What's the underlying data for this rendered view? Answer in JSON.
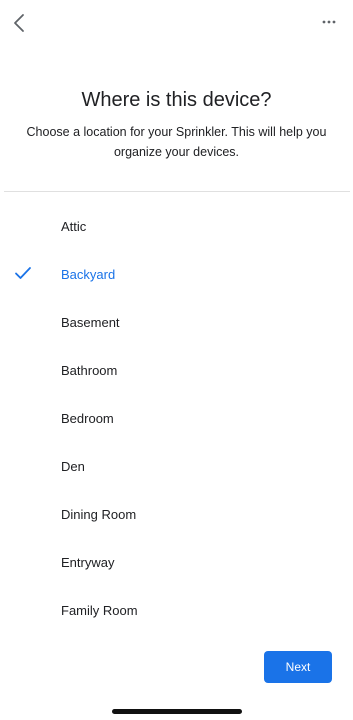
{
  "header": {
    "title": "Where is this device?",
    "subtitle": "Choose a location for your Sprinkler. This will help you organize your devices."
  },
  "locations": [
    {
      "label": "Attic",
      "selected": false
    },
    {
      "label": "Backyard",
      "selected": true
    },
    {
      "label": "Basement",
      "selected": false
    },
    {
      "label": "Bathroom",
      "selected": false
    },
    {
      "label": "Bedroom",
      "selected": false
    },
    {
      "label": "Den",
      "selected": false
    },
    {
      "label": "Dining Room",
      "selected": false
    },
    {
      "label": "Entryway",
      "selected": false
    },
    {
      "label": "Family Room",
      "selected": false
    }
  ],
  "footer": {
    "next_label": "Next"
  },
  "icons": {
    "back": "back-arrow-icon",
    "more": "more-horizontal-icon",
    "check": "checkmark-icon"
  },
  "colors": {
    "accent": "#1a73e8",
    "text": "#202124",
    "divider": "#e0e0e0"
  }
}
